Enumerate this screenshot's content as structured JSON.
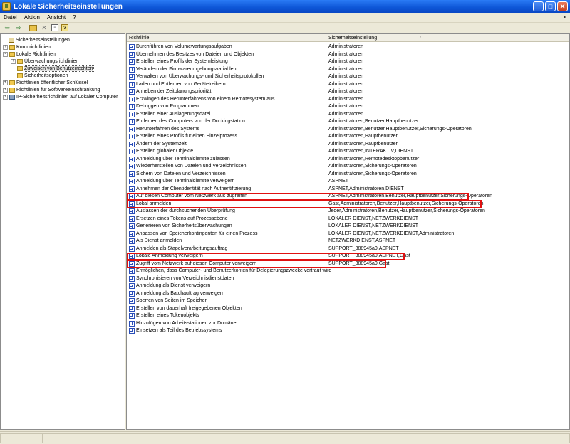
{
  "window": {
    "title": "Lokale Sicherheitseinstellungen"
  },
  "window_buttons": {
    "minimize": "_",
    "maximize": "□",
    "close": "✕"
  },
  "menu": {
    "items": [
      "Datei",
      "Aktion",
      "Ansicht",
      "?"
    ]
  },
  "toolbar": {
    "icons": [
      "back-arrow-icon",
      "forward-arrow-icon",
      "up-folder-icon",
      "delete-icon",
      "properties-icon",
      "help-icon"
    ]
  },
  "tree": {
    "items": [
      {
        "label": "Sicherheitseinstellungen",
        "level": 0,
        "expander": "-",
        "icon": "root"
      },
      {
        "label": "Kontorichtlinien",
        "level": 1,
        "expander": "+",
        "icon": "folder"
      },
      {
        "label": "Lokale Richtlinien",
        "level": 1,
        "expander": "-",
        "icon": "folder"
      },
      {
        "label": "Überwachungsrichtlinien",
        "level": 2,
        "expander": "+",
        "icon": "folder"
      },
      {
        "label": "Zuweisen von Benutzerrechten",
        "level": 2,
        "expander": "",
        "icon": "folder",
        "selected": true
      },
      {
        "label": "Sicherheitsoptionen",
        "level": 2,
        "expander": "",
        "icon": "folder"
      },
      {
        "label": "Richtlinien öffentlicher Schlüssel",
        "level": 1,
        "expander": "+",
        "icon": "folder"
      },
      {
        "label": "Richtlinien für Softwareeinschränkung",
        "level": 1,
        "expander": "+",
        "icon": "folder"
      },
      {
        "label": "IP-Sicherheitsrichtlinien auf Lokaler Computer",
        "level": 1,
        "expander": "+",
        "icon": "pc"
      }
    ]
  },
  "list": {
    "columns": [
      "Richtlinie",
      "Sicherheitseinstellung"
    ],
    "sort_indicator": "/",
    "rows": [
      [
        "Durchführen von Volumewartungsaufgaben",
        "Administratoren"
      ],
      [
        "Übernehmen des Besitzes von Dateien und Objekten",
        "Administratoren"
      ],
      [
        "Erstellen eines Profils der Systemleistung",
        "Administratoren"
      ],
      [
        "Verändern der Firmwareumgebungsvariablen",
        "Administratoren"
      ],
      [
        "Verwalten von Überwachungs- und Sicherheitsprotokollen",
        "Administratoren"
      ],
      [
        "Laden und Entfernen von Gerätetreibern",
        "Administratoren"
      ],
      [
        "Anheben der Zeitplanungspriorität",
        "Administratoren"
      ],
      [
        "Erzwingen des Herunterfahrens von einem Remotesystem aus",
        "Administratoren"
      ],
      [
        "Debuggen von Programmen",
        "Administratoren"
      ],
      [
        "Erstellen einer Auslagerungsdatei",
        "Administratoren"
      ],
      [
        "Entfernen des Computers von der Dockingstation",
        "Administratoren,Benutzer,Hauptbenutzer"
      ],
      [
        "Herunterfahren des Systems",
        "Administratoren,Benutzer,Hauptbenutzer,Sicherungs-Operatoren"
      ],
      [
        "Erstellen eines Profils für einen Einzelprozess",
        "Administratoren,Hauptbenutzer"
      ],
      [
        "Ändern der Systemzeit",
        "Administratoren,Hauptbenutzer"
      ],
      [
        "Erstellen globaler Objekte",
        "Administratoren,INTERAKTIV,DIENST"
      ],
      [
        "Anmeldung über Terminaldienste zulassen",
        "Administratoren,Remotedesktopbenutzer"
      ],
      [
        "Wiederherstellen von Dateien und Verzeichnissen",
        "Administratoren,Sicherungs-Operatoren"
      ],
      [
        "Sichern von Dateien und Verzeichnissen",
        "Administratoren,Sicherungs-Operatoren"
      ],
      [
        "Anmeldung über Terminaldienste verweigern",
        "ASPNET"
      ],
      [
        "Annehmen der Clientidentität nach Authentifizierung",
        "ASPNET,Administratoren,DIENST"
      ],
      [
        "Auf diesen Computer vom Netzwerk aus zugreifen",
        "ASPNET,Administratoren,Benutzer,Hauptbenutzer,Sicherungs-Operatoren"
      ],
      [
        "Lokal anmelden",
        "Gast,Administratoren,Benutzer,Hauptbenutzer,Sicherungs-Operatoren"
      ],
      [
        "Auslassen der durchsuchenden Überprüfung",
        "Jeder,Administratoren,Benutzer,Hauptbenutzer,Sicherungs-Operatoren"
      ],
      [
        "Ersetzen eines Tokens auf Prozessebene",
        "LOKALER DIENST,NETZWERKDIENST"
      ],
      [
        "Generieren von Sicherheitsüberwachungen",
        "LOKALER DIENST,NETZWERKDIENST"
      ],
      [
        "Anpassen von Speicherkontingenten für einen Prozess",
        "LOKALER DIENST,NETZWERKDIENST,Administratoren"
      ],
      [
        "Als Dienst anmelden",
        "NETZWERKDIENST,ASPNET"
      ],
      [
        "Anmelden als Stapelverarbeitungsauftrag",
        "SUPPORT_388945a0,ASPNET"
      ],
      [
        "Lokale Anmeldung verweigern",
        "SUPPORT_388945a0,ASPNET,Gast"
      ],
      [
        "Zugriff vom Netzwerk auf diesen Computer verweigern",
        "SUPPORT_388945a0,Gast"
      ],
      [
        "Ermöglichen, dass Computer- und Benutzerkonten für Delegierungszwecke vertraut wird",
        ""
      ],
      [
        "Synchronisieren von Verzeichnisdienstdaten",
        ""
      ],
      [
        "Anmeldung als Dienst verweigern",
        ""
      ],
      [
        "Anmeldung als Batchauftrag verweigern",
        ""
      ],
      [
        "Sperren von Seiten im Speicher",
        ""
      ],
      [
        "Erstellen von dauerhaft freigegebenen Objekten",
        ""
      ],
      [
        "Erstellen eines Tokenobjekts",
        ""
      ],
      [
        "Hinzufügen von Arbeitsstationen zur Domäne",
        ""
      ],
      [
        "Einsetzen als Teil des Betriebssystems",
        ""
      ]
    ],
    "highlighted_rows": [
      20,
      21,
      28,
      29
    ]
  },
  "colors": {
    "titlebar": "#0d55d6",
    "highlight_box": "#e01010",
    "icon_blue": "#2b4fb8"
  }
}
